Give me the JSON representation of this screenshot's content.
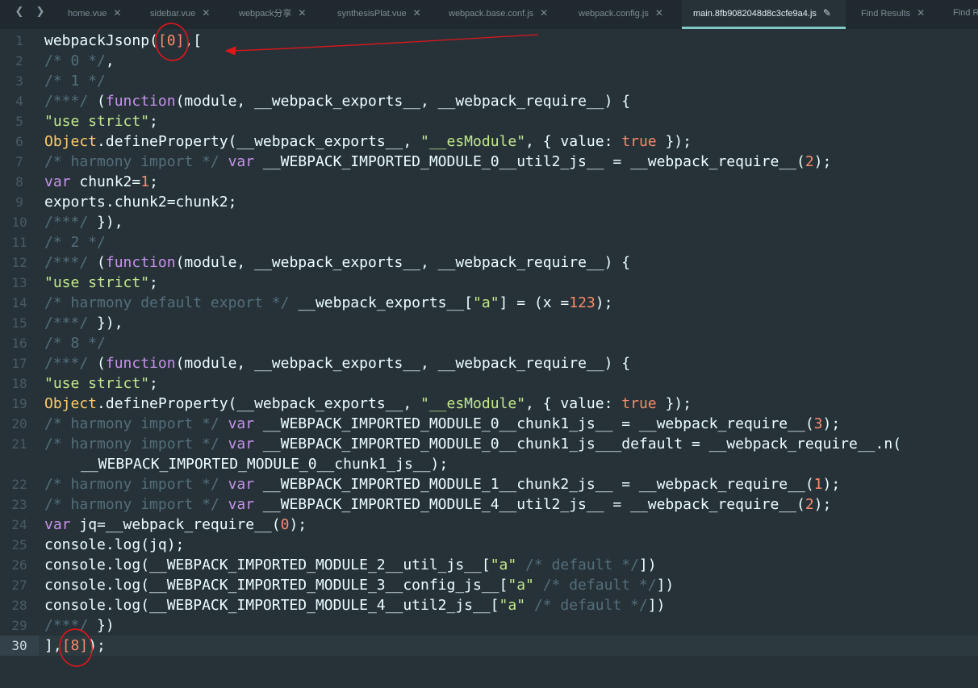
{
  "tabbar": {
    "back_glyph": "❮",
    "forward_glyph": "❯",
    "tabs": [
      {
        "label": "home.vue",
        "close": "✕"
      },
      {
        "label": "sidebar.vue",
        "close": "✕"
      },
      {
        "label": "webpack分享",
        "close": "✕"
      },
      {
        "label": "synthesisPlat.vue",
        "close": "✕"
      },
      {
        "label": "webpack.base.conf.js",
        "close": "✕"
      },
      {
        "label": "webpack.config.js",
        "close": "✕"
      },
      {
        "label": "main.8fb9082048d8c3cfe9a4.js",
        "close": "✎"
      },
      {
        "label": "Find Results",
        "close": "✕"
      },
      {
        "label": "Find Results",
        "close": ""
      }
    ],
    "active_tab": 6
  },
  "editor": {
    "active_line": 30,
    "lines": [
      {
        "n": "1",
        "code": [
          [
            "t",
            "webpackJsonp("
          ],
          [
            "n",
            "[0]"
          ],
          [
            "t",
            ",["
          ]
        ]
      },
      {
        "n": "2",
        "code": [
          [
            "c",
            "/* 0 */"
          ],
          [
            "t",
            ","
          ]
        ]
      },
      {
        "n": "3",
        "code": [
          [
            "c",
            "/* 1 */"
          ]
        ]
      },
      {
        "n": "4",
        "code": [
          [
            "c",
            "/***/ "
          ],
          [
            "t",
            "("
          ],
          [
            "k",
            "function"
          ],
          [
            "t",
            "(module, __webpack_exports__, __webpack_require__) {"
          ]
        ]
      },
      {
        "n": "5",
        "code": [
          [
            "s",
            "\"use strict\""
          ],
          [
            "t",
            ";"
          ]
        ]
      },
      {
        "n": "6",
        "code": [
          [
            "o",
            "Object"
          ],
          [
            "t",
            ".defineProperty(__webpack_exports__, "
          ],
          [
            "s",
            "\"__esModule\""
          ],
          [
            "t",
            ", { value: "
          ],
          [
            "n",
            "true"
          ],
          [
            "t",
            " });"
          ]
        ]
      },
      {
        "n": "7",
        "code": [
          [
            "c",
            "/* harmony import */ "
          ],
          [
            "k",
            "var"
          ],
          [
            "t",
            " __WEBPACK_IMPORTED_MODULE_0__util2_js__ = __webpack_require__("
          ],
          [
            "n",
            "2"
          ],
          [
            "t",
            ");"
          ]
        ]
      },
      {
        "n": "8",
        "code": [
          [
            "k",
            "var"
          ],
          [
            "t",
            " chunk2="
          ],
          [
            "n",
            "1"
          ],
          [
            "t",
            ";"
          ]
        ]
      },
      {
        "n": "9",
        "code": [
          [
            "t",
            "exports.chunk2=chunk2;"
          ]
        ]
      },
      {
        "n": "10",
        "code": [
          [
            "c",
            "/***/ "
          ],
          [
            "t",
            "}),"
          ]
        ]
      },
      {
        "n": "11",
        "code": [
          [
            "c",
            "/* 2 */"
          ]
        ]
      },
      {
        "n": "12",
        "code": [
          [
            "c",
            "/***/ "
          ],
          [
            "t",
            "("
          ],
          [
            "k",
            "function"
          ],
          [
            "t",
            "(module, __webpack_exports__, __webpack_require__) {"
          ]
        ]
      },
      {
        "n": "13",
        "code": [
          [
            "s",
            "\"use strict\""
          ],
          [
            "t",
            ";"
          ]
        ]
      },
      {
        "n": "14",
        "code": [
          [
            "c",
            "/* harmony default export */ "
          ],
          [
            "t",
            "__webpack_exports__["
          ],
          [
            "s",
            "\"a\""
          ],
          [
            "t",
            "] = (x ="
          ],
          [
            "n",
            "123"
          ],
          [
            "t",
            ");"
          ]
        ]
      },
      {
        "n": "15",
        "code": [
          [
            "c",
            "/***/ "
          ],
          [
            "t",
            "}),"
          ]
        ]
      },
      {
        "n": "16",
        "code": [
          [
            "c",
            "/* 8 */"
          ]
        ]
      },
      {
        "n": "17",
        "code": [
          [
            "c",
            "/***/ "
          ],
          [
            "t",
            "("
          ],
          [
            "k",
            "function"
          ],
          [
            "t",
            "(module, __webpack_exports__, __webpack_require__) {"
          ]
        ]
      },
      {
        "n": "18",
        "code": [
          [
            "s",
            "\"use strict\""
          ],
          [
            "t",
            ";"
          ]
        ]
      },
      {
        "n": "19",
        "code": [
          [
            "o",
            "Object"
          ],
          [
            "t",
            ".defineProperty(__webpack_exports__, "
          ],
          [
            "s",
            "\"__esModule\""
          ],
          [
            "t",
            ", { value: "
          ],
          [
            "n",
            "true"
          ],
          [
            "t",
            " });"
          ]
        ]
      },
      {
        "n": "20",
        "code": [
          [
            "c",
            "/* harmony import */ "
          ],
          [
            "k",
            "var"
          ],
          [
            "t",
            " __WEBPACK_IMPORTED_MODULE_0__chunk1_js__ = __webpack_require__("
          ],
          [
            "n",
            "3"
          ],
          [
            "t",
            ");"
          ]
        ]
      },
      {
        "n": "21",
        "code": [
          [
            "c",
            "/* harmony import */ "
          ],
          [
            "k",
            "var"
          ],
          [
            "t",
            " __WEBPACK_IMPORTED_MODULE_0__chunk1_js___default = __webpack_require__.n("
          ]
        ],
        "cont": "__WEBPACK_IMPORTED_MODULE_0__chunk1_js__);"
      },
      {
        "n": "22",
        "code": [
          [
            "c",
            "/* harmony import */ "
          ],
          [
            "k",
            "var"
          ],
          [
            "t",
            " __WEBPACK_IMPORTED_MODULE_1__chunk2_js__ = __webpack_require__("
          ],
          [
            "n",
            "1"
          ],
          [
            "t",
            ");"
          ]
        ]
      },
      {
        "n": "23",
        "code": [
          [
            "c",
            "/* harmony import */ "
          ],
          [
            "k",
            "var"
          ],
          [
            "t",
            " __WEBPACK_IMPORTED_MODULE_4__util2_js__ = __webpack_require__("
          ],
          [
            "n",
            "2"
          ],
          [
            "t",
            ");"
          ]
        ]
      },
      {
        "n": "24",
        "code": [
          [
            "k",
            "var"
          ],
          [
            "t",
            " jq=__webpack_require__("
          ],
          [
            "n",
            "0"
          ],
          [
            "t",
            ");"
          ]
        ]
      },
      {
        "n": "25",
        "code": [
          [
            "t",
            "console.log(jq);"
          ]
        ]
      },
      {
        "n": "26",
        "code": [
          [
            "t",
            "console.log(__WEBPACK_IMPORTED_MODULE_2__util_js__["
          ],
          [
            "s",
            "\"a\""
          ],
          [
            "c",
            " /* default */"
          ],
          [
            "t",
            "])"
          ]
        ]
      },
      {
        "n": "27",
        "code": [
          [
            "t",
            "console.log(__WEBPACK_IMPORTED_MODULE_3__config_js__["
          ],
          [
            "s",
            "\"a\""
          ],
          [
            "c",
            " /* default */"
          ],
          [
            "t",
            "])"
          ]
        ]
      },
      {
        "n": "28",
        "code": [
          [
            "t",
            "console.log(__WEBPACK_IMPORTED_MODULE_4__util2_js__["
          ],
          [
            "s",
            "\"a\""
          ],
          [
            "c",
            " /* default */"
          ],
          [
            "t",
            "])"
          ]
        ]
      },
      {
        "n": "29",
        "code": [
          [
            "c",
            "/***/ "
          ],
          [
            "t",
            "})"
          ]
        ]
      },
      {
        "n": "30",
        "code": [
          [
            "t",
            "],"
          ],
          [
            "n",
            "[8]"
          ],
          [
            "t",
            ");"
          ]
        ]
      }
    ]
  },
  "colors": {
    "background": "#263238",
    "comment": "#546e7a",
    "keyword": "#c792ea",
    "string": "#c3e88d",
    "number": "#f78c6c",
    "object": "#ffcb6b",
    "text": "#eeffff",
    "annotation": "#e0161b",
    "tab_accent": "#80cbc4"
  }
}
